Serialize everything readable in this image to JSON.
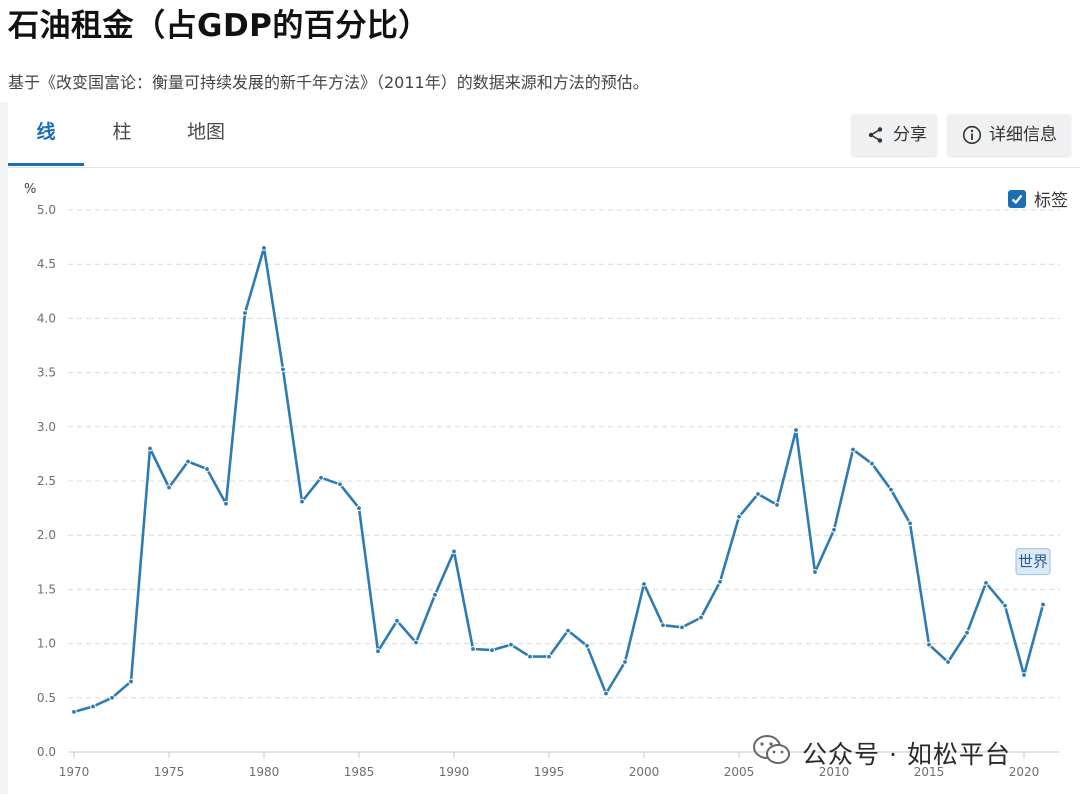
{
  "page": {
    "title": "石油租金（占GDP的百分比）",
    "subtitle": "基于《改变国富论：衡量可持续发展的新千年方法》（2011年）的数据来源和方法的预估。"
  },
  "tabs": [
    {
      "label": "线",
      "active": true
    },
    {
      "label": "柱",
      "active": false
    },
    {
      "label": "地图",
      "active": false
    }
  ],
  "toolbar": {
    "share_label": "分享",
    "share_icon": "share-icon",
    "details_label": "详细信息",
    "details_icon": "info-icon"
  },
  "legend": {
    "label_toggle": "标签",
    "checked": true
  },
  "watermark": {
    "text": "公众号 · 如松平台",
    "icon": "wechat-icon"
  },
  "colors": {
    "series": "#2e7bb4",
    "accent": "#1c6fb3",
    "grid": "#d9d9d9"
  },
  "chart_data": {
    "type": "line",
    "unit": "%",
    "ylim": [
      0,
      5
    ],
    "yticks": [
      0.0,
      0.5,
      1.0,
      1.5,
      2.0,
      2.5,
      3.0,
      3.5,
      4.0,
      4.5,
      5.0
    ],
    "xlim": [
      1970,
      2021
    ],
    "xticks": [
      1970,
      1975,
      1980,
      1985,
      1990,
      1995,
      2000,
      2005,
      2010,
      2015,
      2020
    ],
    "grid": true,
    "series": [
      {
        "name": "世界",
        "x": [
          1970,
          1971,
          1972,
          1973,
          1974,
          1975,
          1976,
          1977,
          1978,
          1979,
          1980,
          1981,
          1982,
          1983,
          1984,
          1985,
          1986,
          1987,
          1988,
          1989,
          1990,
          1991,
          1992,
          1993,
          1994,
          1995,
          1996,
          1997,
          1998,
          1999,
          2000,
          2001,
          2002,
          2003,
          2004,
          2005,
          2006,
          2007,
          2008,
          2009,
          2010,
          2011,
          2012,
          2013,
          2014,
          2015,
          2016,
          2017,
          2018,
          2019,
          2020,
          2021
        ],
        "values": [
          0.37,
          0.42,
          0.5,
          0.65,
          2.8,
          2.44,
          2.68,
          2.61,
          2.29,
          4.05,
          4.65,
          3.53,
          2.31,
          2.53,
          2.47,
          2.25,
          0.93,
          1.21,
          1.01,
          1.45,
          1.85,
          0.95,
          0.94,
          0.99,
          0.88,
          0.88,
          1.12,
          0.98,
          0.54,
          0.83,
          1.55,
          1.17,
          1.15,
          1.24,
          1.57,
          2.17,
          2.38,
          2.28,
          2.97,
          1.66,
          2.05,
          2.79,
          2.66,
          2.42,
          2.11,
          0.99,
          0.83,
          1.1,
          1.56,
          1.35,
          0.71,
          1.36
        ]
      }
    ]
  }
}
